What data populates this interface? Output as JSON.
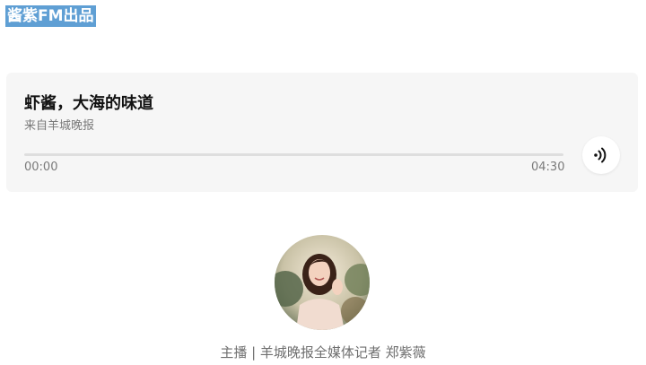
{
  "brand": {
    "label": "酱紫FM出品",
    "background_color": "#5f9fd4"
  },
  "player": {
    "title": "虾酱，大海的味道",
    "source": "来自羊城晚报",
    "current_time": "00:00",
    "total_time": "04:30",
    "progress_fraction": 0,
    "play_icon": "sound-waves-icon"
  },
  "anchor": {
    "avatar_icon": "anchor-avatar-photo",
    "caption": "主播 | 羊城晚报全媒体记者 郑紫薇"
  }
}
